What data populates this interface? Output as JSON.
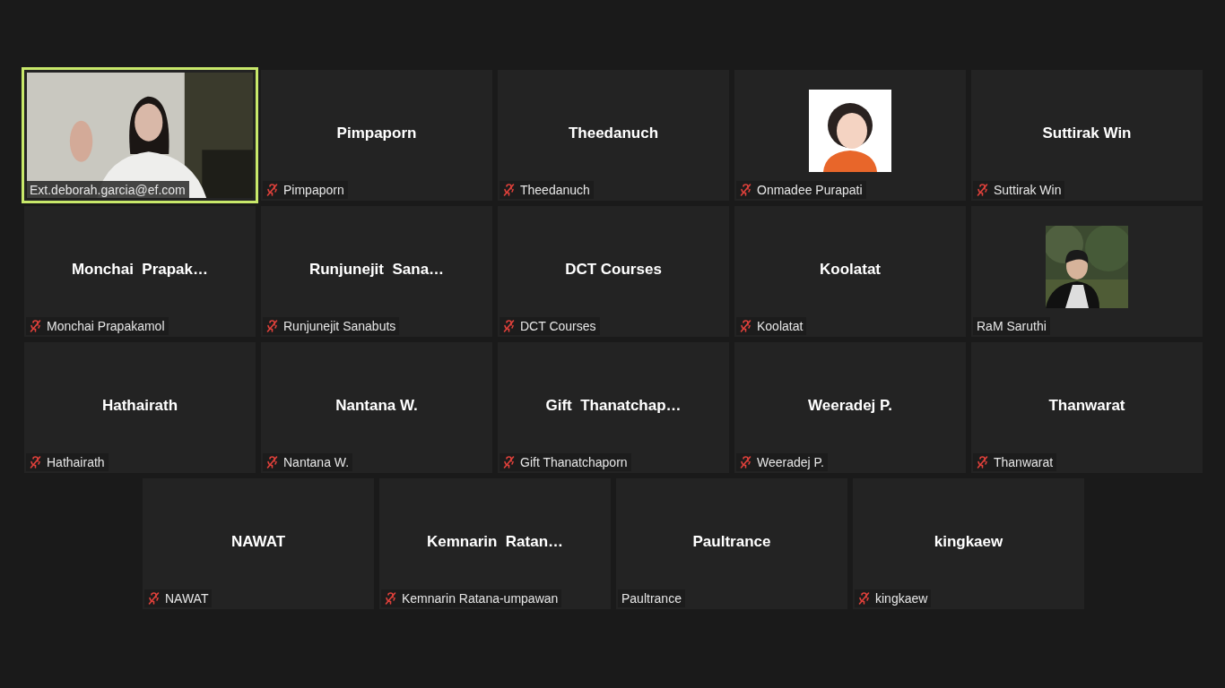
{
  "tiles": [
    {
      "kind": "video",
      "name": "Ext.deborah.garcia@ef.com",
      "muted": false,
      "active_speaker": true
    },
    {
      "kind": "name",
      "display_name": "Pimpaporn",
      "name": "Pimpaporn",
      "muted": true,
      "active_speaker": false
    },
    {
      "kind": "name",
      "display_name": "Theedanuch",
      "name": "Theedanuch",
      "muted": true,
      "active_speaker": false
    },
    {
      "kind": "avatar",
      "name": "Onmadee Purapati",
      "muted": true,
      "active_speaker": false
    },
    {
      "kind": "name",
      "display_name": "Suttirak Win",
      "name": "Suttirak Win",
      "muted": true,
      "active_speaker": false
    },
    {
      "kind": "name",
      "display_name": "Monchai  Prapak…",
      "name": "Monchai Prapakamol",
      "muted": true,
      "active_speaker": false
    },
    {
      "kind": "name",
      "display_name": "Runjunejit  Sana…",
      "name": "Runjunejit Sanabuts",
      "muted": true,
      "active_speaker": false
    },
    {
      "kind": "name",
      "display_name": "DCT Courses",
      "name": "DCT Courses",
      "muted": true,
      "active_speaker": false
    },
    {
      "kind": "name",
      "display_name": "Koolatat",
      "name": "Koolatat",
      "muted": true,
      "active_speaker": false
    },
    {
      "name": "RaM Saruthi",
      "muted": false,
      "active_speaker": false
    },
    {
      "kind": "name",
      "display_name": "Hathairath",
      "name": "Hathairath",
      "muted": true,
      "active_speaker": false
    },
    {
      "kind": "name",
      "display_name": "Nantana W.",
      "name": "Nantana W.",
      "muted": true,
      "active_speaker": false
    },
    {
      "kind": "name",
      "display_name": "Gift  Thanatchap…",
      "name": "Gift Thanatchaporn",
      "muted": true,
      "active_speaker": false
    },
    {
      "kind": "name",
      "display_name": "Weeradej P.",
      "name": "Weeradej P.",
      "muted": true,
      "active_speaker": false
    },
    {
      "kind": "name",
      "display_name": "Thanwarat",
      "name": "Thanwarat",
      "muted": true,
      "active_speaker": false
    },
    {
      "kind": "name",
      "display_name": "NAWAT",
      "name": "NAWAT",
      "muted": true,
      "active_speaker": false
    },
    {
      "kind": "name",
      "display_name": "Kemnarin  Ratan…",
      "name": "Kemnarin Ratana-umpawan",
      "muted": true,
      "active_speaker": false
    },
    {
      "kind": "name",
      "display_name": "Paultrance",
      "name": "Paultrance",
      "muted": false,
      "active_speaker": false
    },
    {
      "kind": "name",
      "display_name": "kingkaew",
      "name": "kingkaew",
      "muted": true,
      "active_speaker": false
    }
  ]
}
